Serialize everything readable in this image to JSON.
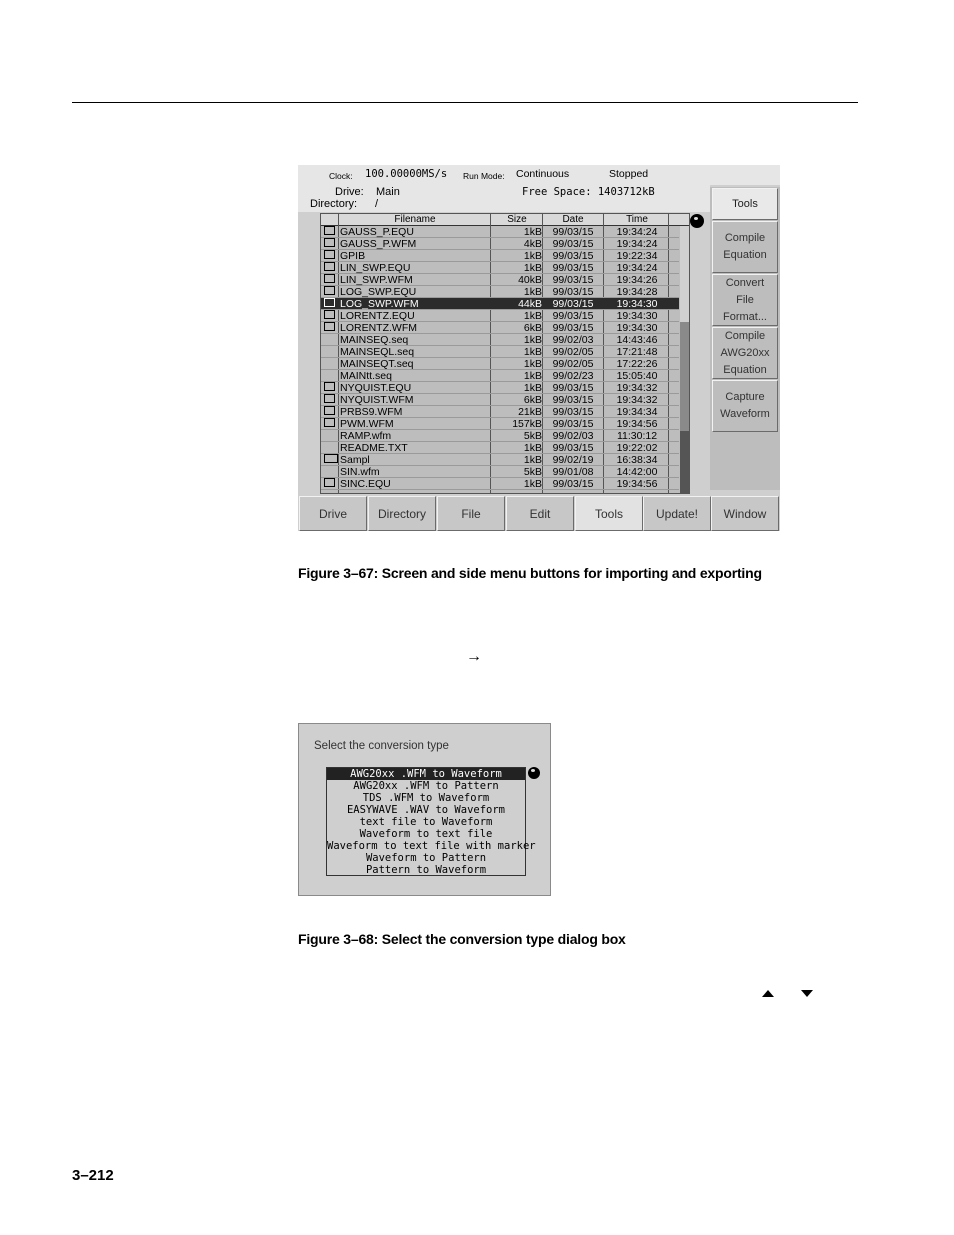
{
  "screen": {
    "status": {
      "clock_label": "Clock:",
      "clock_value": "100.00000MS/s",
      "run_mode_label": "Run Mode:",
      "run_mode_value": "Continuous",
      "state": "Stopped"
    },
    "drive_label": "Drive:",
    "drive_value": "Main",
    "free_space": "Free Space: 1403712kB",
    "directory_label": "Directory:",
    "directory_value": "/",
    "columns": [
      "Filename",
      "Size",
      "Date",
      "Time"
    ],
    "files": [
      {
        "name": "GAUSS_P.EQU",
        "size": "1kB",
        "date": "99/03/15",
        "time": "19:34:24",
        "icon": "lock"
      },
      {
        "name": "GAUSS_P.WFM",
        "size": "4kB",
        "date": "99/03/15",
        "time": "19:34:24",
        "icon": "lock"
      },
      {
        "name": "GPIB",
        "size": "1kB",
        "date": "99/03/15",
        "time": "19:22:34",
        "icon": "lock"
      },
      {
        "name": "LIN_SWP.EQU",
        "size": "1kB",
        "date": "99/03/15",
        "time": "19:34:24",
        "icon": "lock"
      },
      {
        "name": "LIN_SWP.WFM",
        "size": "40kB",
        "date": "99/03/15",
        "time": "19:34:26",
        "icon": "lock"
      },
      {
        "name": "LOG_SWP.EQU",
        "size": "1kB",
        "date": "99/03/15",
        "time": "19:34:28",
        "icon": "lock"
      },
      {
        "name": "LOG_SWP.WFM",
        "size": "44kB",
        "date": "99/03/15",
        "time": "19:34:30",
        "icon": "lock",
        "selected": true
      },
      {
        "name": "LORENTZ.EQU",
        "size": "1kB",
        "date": "99/03/15",
        "time": "19:34:30",
        "icon": "lock"
      },
      {
        "name": "LORENTZ.WFM",
        "size": "6kB",
        "date": "99/03/15",
        "time": "19:34:30",
        "icon": "lock"
      },
      {
        "name": "MAINSEQ.seq",
        "size": "1kB",
        "date": "99/02/03",
        "time": "14:43:46",
        "icon": "none"
      },
      {
        "name": "MAINSEQL.seq",
        "size": "1kB",
        "date": "99/02/05",
        "time": "17:21:48",
        "icon": "none"
      },
      {
        "name": "MAINSEQT.seq",
        "size": "1kB",
        "date": "99/02/05",
        "time": "17:22:26",
        "icon": "none"
      },
      {
        "name": "MAINtt.seq",
        "size": "1kB",
        "date": "99/02/23",
        "time": "15:05:40",
        "icon": "none"
      },
      {
        "name": "NYQUIST.EQU",
        "size": "1kB",
        "date": "99/03/15",
        "time": "19:34:32",
        "icon": "lock"
      },
      {
        "name": "NYQUIST.WFM",
        "size": "6kB",
        "date": "99/03/15",
        "time": "19:34:32",
        "icon": "lock"
      },
      {
        "name": "PRBS9.WFM",
        "size": "21kB",
        "date": "99/03/15",
        "time": "19:34:34",
        "icon": "lock"
      },
      {
        "name": "PWM.WFM",
        "size": "157kB",
        "date": "99/03/15",
        "time": "19:34:56",
        "icon": "lock"
      },
      {
        "name": "RAMP.wfm",
        "size": "5kB",
        "date": "99/02/03",
        "time": "11:30:12",
        "icon": "none"
      },
      {
        "name": "README.TXT",
        "size": "1kB",
        "date": "99/03/15",
        "time": "19:22:02",
        "icon": "none"
      },
      {
        "name": "Sampl",
        "size": "1kB",
        "date": "99/02/19",
        "time": "16:38:34",
        "icon": "folder"
      },
      {
        "name": "SIN.wfm",
        "size": "5kB",
        "date": "99/01/08",
        "time": "14:42:00",
        "icon": "none"
      },
      {
        "name": "SINC.EQU",
        "size": "1kB",
        "date": "99/03/15",
        "time": "19:34:56",
        "icon": "lock"
      }
    ],
    "side_menu": {
      "title": "Tools",
      "buttons": [
        "Compile\nEquation",
        "Convert\nFile\nFormat...",
        "Compile\nAWG20xx\nEquation",
        "Capture\nWaveform"
      ]
    },
    "bottom_menu": [
      "Drive",
      "Directory",
      "File",
      "Edit",
      "Tools",
      "Update!",
      "Window"
    ],
    "active_bottom": "Tools"
  },
  "caption1": "Figure 3–67: Screen and side menu buttons for importing and exporting",
  "arrow_glyph": "→",
  "dialog": {
    "title": "Select the conversion type",
    "options": [
      "AWG20xx .WFM to Waveform",
      "AWG20xx .WFM to Pattern",
      "TDS .WFM to Waveform",
      "EASYWAVE .WAV to Waveform",
      "text file to Waveform",
      "Waveform to text file",
      "Waveform to text file with marker",
      "Waveform to Pattern",
      "Pattern to Waveform"
    ],
    "selected_index": 0
  },
  "caption2": "Figure 3–68: Select the conversion type dialog box",
  "page_number": "3–212"
}
